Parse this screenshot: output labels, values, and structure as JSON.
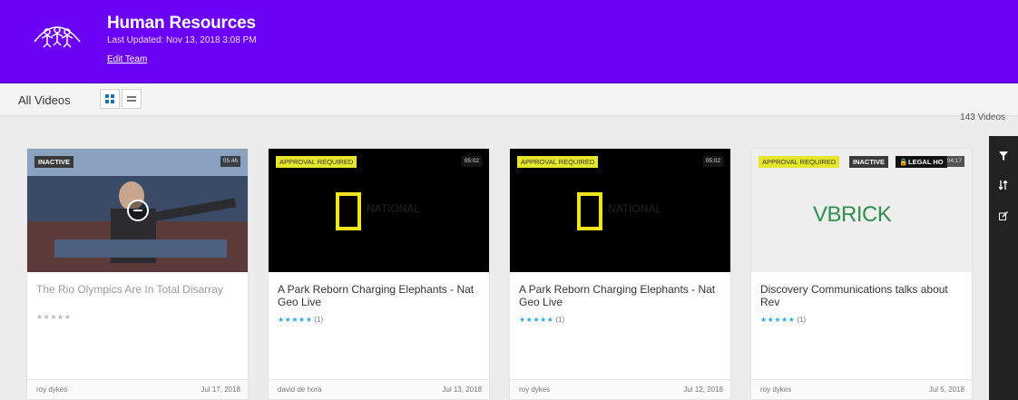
{
  "header": {
    "title": "Human Resources",
    "updated": "Last Updated: Nov 13, 2018 3:08 PM",
    "edit_label": "Edit Team",
    "brand_color": "#6a00f4",
    "logo_icon": "people-circle-icon"
  },
  "toolbar": {
    "title": "All Videos",
    "grid_icon": "grid-view-icon",
    "list_icon": "list-view-icon"
  },
  "video_count": "143 Videos",
  "videos": [
    {
      "title": "The Rio Olympics Are In Total Disarray",
      "badges": [
        "INACTIVE"
      ],
      "duration": "05:46",
      "rating_stars": "★★★★★",
      "rating_count": "",
      "author": "roy dykes",
      "date": "Jul 17, 2018"
    },
    {
      "title": "A Park Reborn Charging Elephants - Nat Geo Live",
      "badges": [
        "APPROVAL REQUIRED"
      ],
      "duration": "05:02",
      "thumb_text": "NATIONAL",
      "rating_stars": "★★★★★",
      "rating_count": "(1)",
      "author": "david de hora",
      "date": "Jul 13, 2018"
    },
    {
      "title": "A Park Reborn Charging Elephants - Nat Geo Live",
      "badges": [
        "APPROVAL REQUIRED"
      ],
      "duration": "05:02",
      "thumb_text": "NATIONAL",
      "rating_stars": "★★★★★",
      "rating_count": "(1)",
      "author": "roy dykes",
      "date": "Jul 12, 2018"
    },
    {
      "title": "Discovery Communications talks about Rev",
      "badges": [
        "APPROVAL REQUIRED",
        "INACTIVE",
        "LEGAL HO"
      ],
      "duration": "04:17",
      "thumb_text": "VBRICK",
      "rating_stars": "★★★★★",
      "rating_count": "(1)",
      "author": "roy dykes",
      "date": "Jul 5, 2018"
    }
  ],
  "side_panel": {
    "icons": [
      "filter-icon",
      "sort-icon",
      "edit-icon"
    ]
  }
}
